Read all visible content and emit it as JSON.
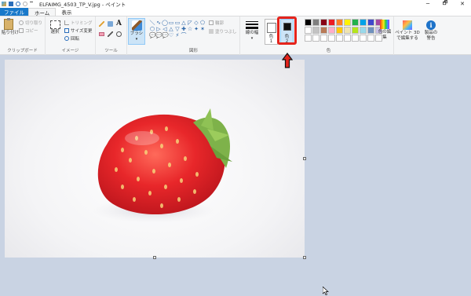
{
  "window": {
    "title": "ELFAIMG_4503_TP_V.jpg - ペイント",
    "minimize": "─",
    "maximize": "🗗",
    "close": "✕"
  },
  "tabs": [
    {
      "label": "ファイル"
    },
    {
      "label": "ホーム"
    },
    {
      "label": "表示"
    }
  ],
  "clipboard": {
    "paste": "貼り付け",
    "cut": "切り取り",
    "copy": "コピー",
    "group": "クリップボード"
  },
  "image": {
    "select": "選択",
    "crop": "トリミング",
    "resize": "サイズ変更",
    "rotate": "回転",
    "group": "イメージ"
  },
  "tools": {
    "group": "ツール",
    "text_tool": "A"
  },
  "brush": {
    "label": "ブラシ"
  },
  "shapes": {
    "group": "図形",
    "outline": "輪郭",
    "fill": "塗りつぶし",
    "glyphs": [
      "＼",
      "∿",
      "◯",
      "▭",
      "▭",
      "△",
      "◸",
      "◇",
      "⬠",
      "⬡",
      "▷",
      "◁",
      "△",
      "▽",
      "✚",
      "☆",
      "✦",
      "✶",
      "💬",
      "💬",
      "💬",
      "♡",
      "⚡",
      "⌒",
      "",
      "",
      ""
    ]
  },
  "size": {
    "label": "線の幅"
  },
  "colors": {
    "group": "色",
    "color1_label": "色",
    "color1_num": "1",
    "color2_label": "色",
    "color2_num": "2",
    "edit": "色の編集",
    "palette": [
      "#000000",
      "#7f7f7f",
      "#880015",
      "#ed1c24",
      "#ff7f27",
      "#fff200",
      "#22b14c",
      "#00a2e8",
      "#3f48cc",
      "#a349a4",
      "#ffffff",
      "#c3c3c3",
      "#b97a57",
      "#ffaec9",
      "#ffc90e",
      "#efe4b0",
      "#b5e61d",
      "#99d9ea",
      "#7092be",
      "#c8bfe7",
      "#ffffff",
      "#ffffff",
      "#ffffff",
      "#ffffff",
      "#ffffff",
      "#ffffff",
      "#ffffff",
      "#ffffff",
      "#ffffff",
      "#ffffff"
    ]
  },
  "paint3d": {
    "label_line1": "ペイント 3D",
    "label_line2": "で編集する"
  },
  "product_alert": {
    "label_line1": "製品の",
    "label_line2": "警告"
  },
  "accent": {
    "highlight": "#e5241c",
    "selection": "#cce4f7",
    "file_tab": "#1979ca"
  }
}
